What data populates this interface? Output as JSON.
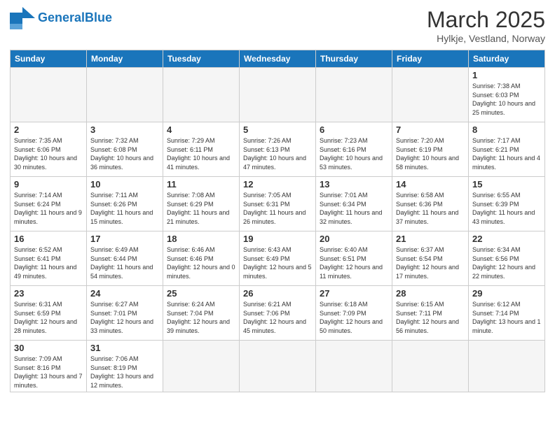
{
  "header": {
    "logo_general": "General",
    "logo_blue": "Blue",
    "month_title": "March 2025",
    "subtitle": "Hylkje, Vestland, Norway"
  },
  "days_of_week": [
    "Sunday",
    "Monday",
    "Tuesday",
    "Wednesday",
    "Thursday",
    "Friday",
    "Saturday"
  ],
  "weeks": [
    [
      {
        "day": "",
        "info": ""
      },
      {
        "day": "",
        "info": ""
      },
      {
        "day": "",
        "info": ""
      },
      {
        "day": "",
        "info": ""
      },
      {
        "day": "",
        "info": ""
      },
      {
        "day": "",
        "info": ""
      },
      {
        "day": "1",
        "info": "Sunrise: 7:38 AM\nSunset: 6:03 PM\nDaylight: 10 hours and 25 minutes."
      }
    ],
    [
      {
        "day": "2",
        "info": "Sunrise: 7:35 AM\nSunset: 6:06 PM\nDaylight: 10 hours and 30 minutes."
      },
      {
        "day": "3",
        "info": "Sunrise: 7:32 AM\nSunset: 6:08 PM\nDaylight: 10 hours and 36 minutes."
      },
      {
        "day": "4",
        "info": "Sunrise: 7:29 AM\nSunset: 6:11 PM\nDaylight: 10 hours and 41 minutes."
      },
      {
        "day": "5",
        "info": "Sunrise: 7:26 AM\nSunset: 6:13 PM\nDaylight: 10 hours and 47 minutes."
      },
      {
        "day": "6",
        "info": "Sunrise: 7:23 AM\nSunset: 6:16 PM\nDaylight: 10 hours and 53 minutes."
      },
      {
        "day": "7",
        "info": "Sunrise: 7:20 AM\nSunset: 6:19 PM\nDaylight: 10 hours and 58 minutes."
      },
      {
        "day": "8",
        "info": "Sunrise: 7:17 AM\nSunset: 6:21 PM\nDaylight: 11 hours and 4 minutes."
      }
    ],
    [
      {
        "day": "9",
        "info": "Sunrise: 7:14 AM\nSunset: 6:24 PM\nDaylight: 11 hours and 9 minutes."
      },
      {
        "day": "10",
        "info": "Sunrise: 7:11 AM\nSunset: 6:26 PM\nDaylight: 11 hours and 15 minutes."
      },
      {
        "day": "11",
        "info": "Sunrise: 7:08 AM\nSunset: 6:29 PM\nDaylight: 11 hours and 21 minutes."
      },
      {
        "day": "12",
        "info": "Sunrise: 7:05 AM\nSunset: 6:31 PM\nDaylight: 11 hours and 26 minutes."
      },
      {
        "day": "13",
        "info": "Sunrise: 7:01 AM\nSunset: 6:34 PM\nDaylight: 11 hours and 32 minutes."
      },
      {
        "day": "14",
        "info": "Sunrise: 6:58 AM\nSunset: 6:36 PM\nDaylight: 11 hours and 37 minutes."
      },
      {
        "day": "15",
        "info": "Sunrise: 6:55 AM\nSunset: 6:39 PM\nDaylight: 11 hours and 43 minutes."
      }
    ],
    [
      {
        "day": "16",
        "info": "Sunrise: 6:52 AM\nSunset: 6:41 PM\nDaylight: 11 hours and 49 minutes."
      },
      {
        "day": "17",
        "info": "Sunrise: 6:49 AM\nSunset: 6:44 PM\nDaylight: 11 hours and 54 minutes."
      },
      {
        "day": "18",
        "info": "Sunrise: 6:46 AM\nSunset: 6:46 PM\nDaylight: 12 hours and 0 minutes."
      },
      {
        "day": "19",
        "info": "Sunrise: 6:43 AM\nSunset: 6:49 PM\nDaylight: 12 hours and 5 minutes."
      },
      {
        "day": "20",
        "info": "Sunrise: 6:40 AM\nSunset: 6:51 PM\nDaylight: 12 hours and 11 minutes."
      },
      {
        "day": "21",
        "info": "Sunrise: 6:37 AM\nSunset: 6:54 PM\nDaylight: 12 hours and 17 minutes."
      },
      {
        "day": "22",
        "info": "Sunrise: 6:34 AM\nSunset: 6:56 PM\nDaylight: 12 hours and 22 minutes."
      }
    ],
    [
      {
        "day": "23",
        "info": "Sunrise: 6:31 AM\nSunset: 6:59 PM\nDaylight: 12 hours and 28 minutes."
      },
      {
        "day": "24",
        "info": "Sunrise: 6:27 AM\nSunset: 7:01 PM\nDaylight: 12 hours and 33 minutes."
      },
      {
        "day": "25",
        "info": "Sunrise: 6:24 AM\nSunset: 7:04 PM\nDaylight: 12 hours and 39 minutes."
      },
      {
        "day": "26",
        "info": "Sunrise: 6:21 AM\nSunset: 7:06 PM\nDaylight: 12 hours and 45 minutes."
      },
      {
        "day": "27",
        "info": "Sunrise: 6:18 AM\nSunset: 7:09 PM\nDaylight: 12 hours and 50 minutes."
      },
      {
        "day": "28",
        "info": "Sunrise: 6:15 AM\nSunset: 7:11 PM\nDaylight: 12 hours and 56 minutes."
      },
      {
        "day": "29",
        "info": "Sunrise: 6:12 AM\nSunset: 7:14 PM\nDaylight: 13 hours and 1 minute."
      }
    ],
    [
      {
        "day": "30",
        "info": "Sunrise: 7:09 AM\nSunset: 8:16 PM\nDaylight: 13 hours and 7 minutes."
      },
      {
        "day": "31",
        "info": "Sunrise: 7:06 AM\nSunset: 8:19 PM\nDaylight: 13 hours and 12 minutes."
      },
      {
        "day": "",
        "info": ""
      },
      {
        "day": "",
        "info": ""
      },
      {
        "day": "",
        "info": ""
      },
      {
        "day": "",
        "info": ""
      },
      {
        "day": "",
        "info": ""
      }
    ]
  ]
}
